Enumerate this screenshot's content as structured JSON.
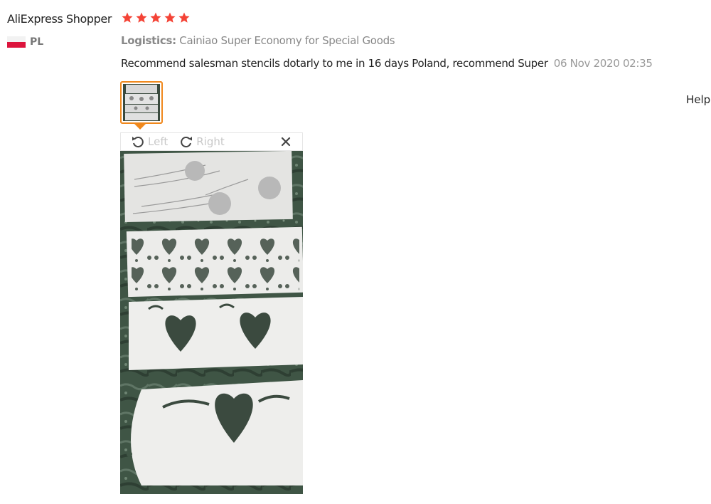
{
  "review": {
    "user_name": "AliExpress Shopper",
    "country_code": "PL",
    "rating": 5,
    "logistics_label": "Logistics:",
    "logistics_value": "Cainiao Super Economy for Special Goods",
    "text": "Recommend salesman stencils dotarly to me in 16 days Poland, recommend Super",
    "date": "06 Nov 2020 02:35"
  },
  "viewer": {
    "rotate_left_label": "Left",
    "rotate_right_label": "Right"
  },
  "side": {
    "help_label": "Help"
  },
  "colors": {
    "star": "#f44336",
    "thumb_border": "#f0881c",
    "flag_red": "#dc143c"
  },
  "icons": {
    "rotate_left": "rotate-left-icon",
    "rotate_right": "rotate-right-icon",
    "close": "close-icon"
  }
}
